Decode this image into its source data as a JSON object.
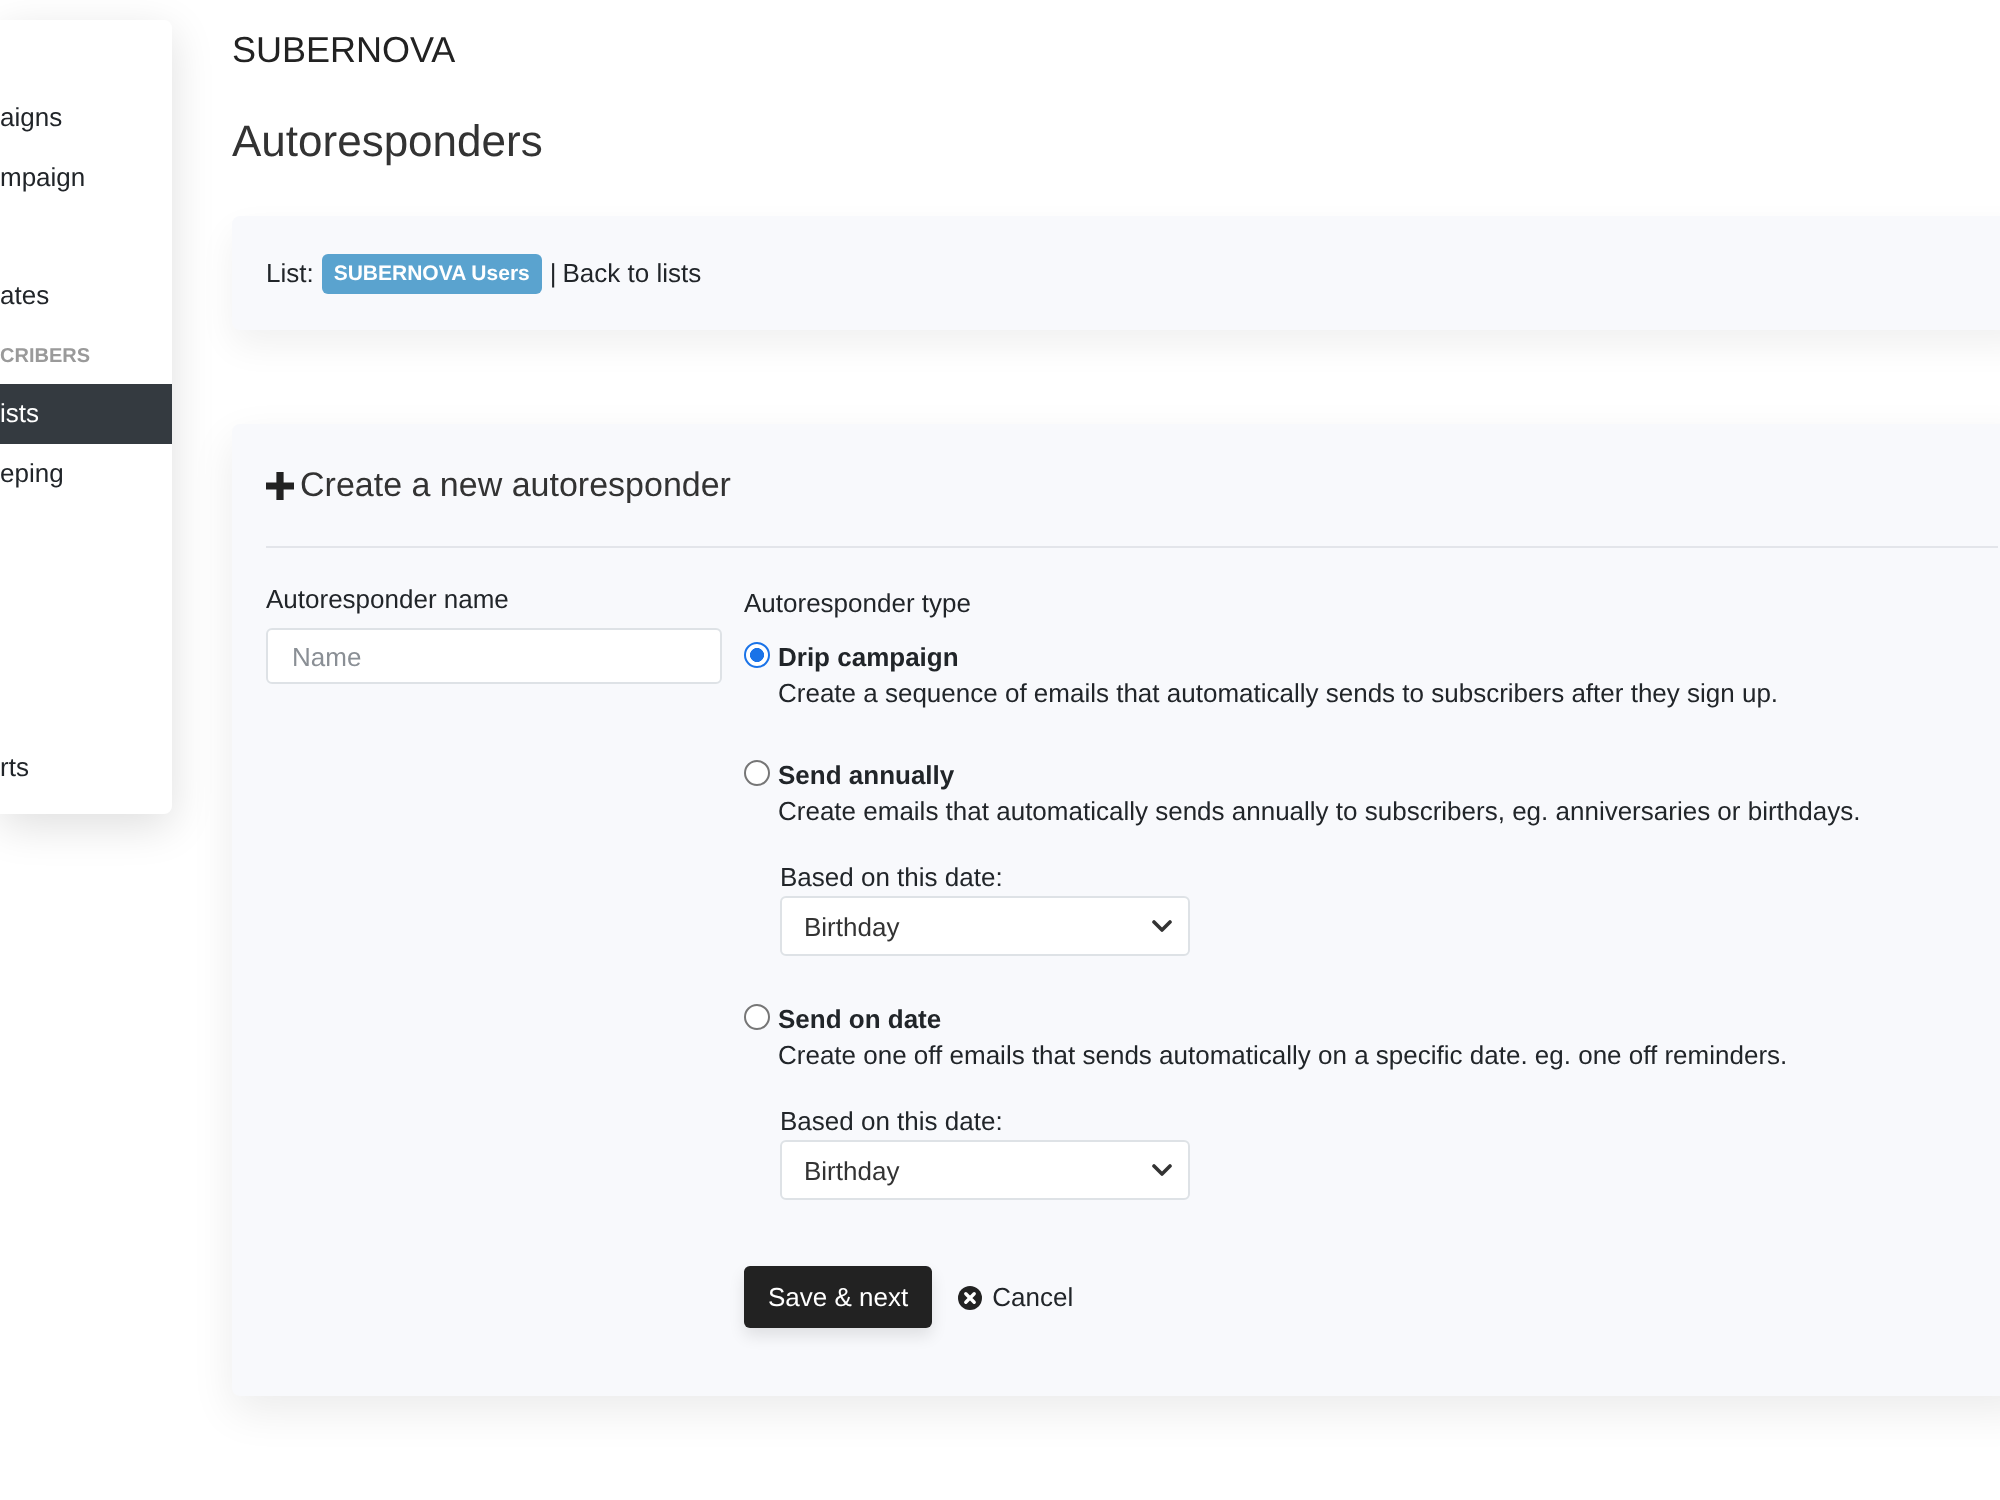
{
  "sidebar": {
    "groups": [
      {
        "items": [
          {
            "label": "aigns",
            "selected": false
          },
          {
            "label": "mpaign",
            "selected": false
          }
        ]
      },
      {
        "items": [
          {
            "label": "ates",
            "selected": false
          }
        ]
      },
      {
        "heading": "CRIBERS",
        "items": [
          {
            "label": "ists",
            "selected": true
          },
          {
            "label": "eping",
            "selected": false
          }
        ]
      },
      {
        "items": [
          {
            "label": "rts",
            "selected": false
          }
        ]
      }
    ]
  },
  "brand": "SUBERNOVA",
  "page_title": "Autoresponders",
  "list_bar": {
    "label": "List:",
    "badge": "SUBERNOVA Users",
    "separator": "|",
    "link": "Back to lists"
  },
  "form": {
    "title": "Create a new autoresponder",
    "name_field": {
      "label": "Autoresponder name",
      "placeholder": "Name"
    },
    "type_label": "Autoresponder type",
    "options": [
      {
        "label": "Drip campaign",
        "description": "Create a sequence of emails that automatically sends to subscribers after they sign up.",
        "selected": true
      },
      {
        "label": "Send annually",
        "description": "Create emails that automatically sends annually to subscribers, eg. anniversaries or birthdays.",
        "selected": false,
        "date_field": {
          "label": "Based on this date:",
          "value": "Birthday"
        }
      },
      {
        "label": "Send on date",
        "description": "Create one off emails that sends automatically on a specific date. eg. one off reminders.",
        "selected": false,
        "date_field": {
          "label": "Based on this date:",
          "value": "Birthday"
        }
      }
    ],
    "buttons": {
      "save": "Save & next",
      "cancel": "Cancel"
    }
  }
}
